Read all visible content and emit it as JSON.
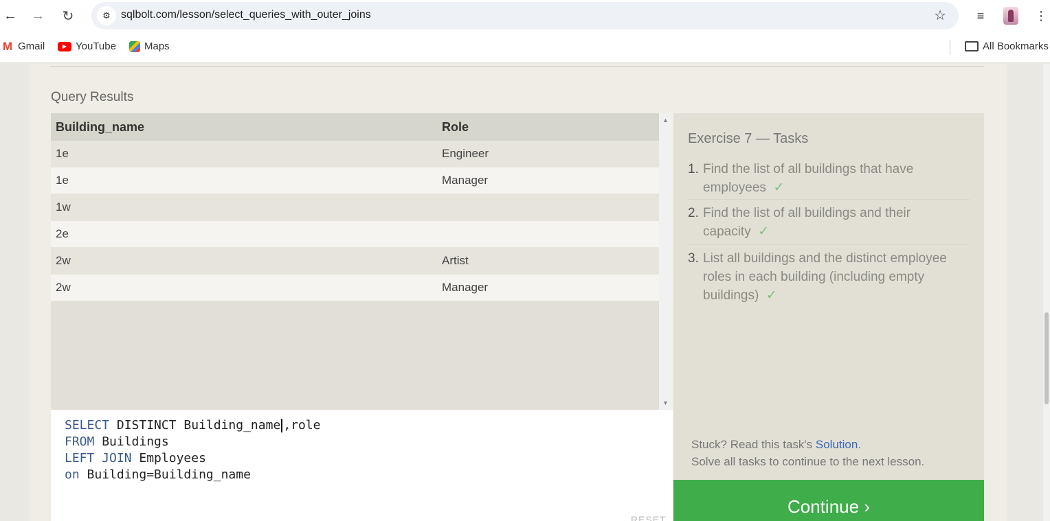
{
  "browser": {
    "url": "sqlbolt.com/lesson/select_queries_with_outer_joins",
    "bookmarks": [
      "Gmail",
      "YouTube",
      "Maps"
    ],
    "all_bookmarks": "All Bookmarks"
  },
  "results": {
    "label": "Query Results",
    "columns": [
      "Building_name",
      "Role"
    ],
    "rows": [
      [
        "1e",
        "Engineer"
      ],
      [
        "1e",
        "Manager"
      ],
      [
        "1w",
        ""
      ],
      [
        "2e",
        ""
      ],
      [
        "2w",
        "Artist"
      ],
      [
        "2w",
        "Manager"
      ]
    ]
  },
  "editor": {
    "lines": [
      {
        "kw": "SELECT",
        "rest": " DISTINCT Building_name",
        "after_cursor": ",role"
      },
      {
        "kw": "FROM",
        "rest": " Buildings",
        "after_cursor": ""
      },
      {
        "kw": "LEFT JOIN",
        "rest": " Employees",
        "after_cursor": ""
      },
      {
        "kw": "on",
        "rest": " Building=Building_name",
        "after_cursor": ""
      }
    ],
    "reset_label": "RESET"
  },
  "tasks": {
    "title": "Exercise 7 — Tasks",
    "items": [
      {
        "num": "1.",
        "text": "Find the list of all buildings that have employees",
        "check": "✓"
      },
      {
        "num": "2.",
        "text": "Find the list of all buildings and their capacity",
        "check": "✓"
      },
      {
        "num": "3.",
        "text": "List all buildings and the distinct employee roles in each building (including empty buildings)",
        "check": "✓"
      }
    ],
    "stuck_prefix": "Stuck? Read this task's ",
    "solution_link": "Solution",
    "stuck_suffix": ".",
    "solve_all": "Solve all tasks to continue to the next lesson.",
    "continue_label": "Continue ›"
  }
}
